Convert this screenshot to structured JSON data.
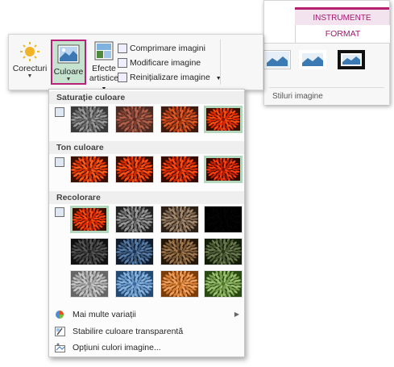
{
  "context_tab": {
    "group_title": "INSTRUMENTE IMAGINE",
    "tab_label": "FORMAT",
    "styles_group_label": "Stiluri imagine"
  },
  "ribbon": {
    "corecturi_label": "Corecturi",
    "culoare_label": "Culoare",
    "efecte_label_1": "Efecte",
    "efecte_label_2": "artistice",
    "comprimare_label": "Comprimare imagini",
    "modificare_label": "Modificare imagine",
    "reinitializare_label": "Reinițializare imagine"
  },
  "menu": {
    "saturatie_header": "Saturație culoare",
    "ton_header": "Ton culoare",
    "recolorare_header": "Recolorare",
    "items": [
      {
        "label": "Mai multe variații",
        "has_submenu": true
      },
      {
        "label": "Stabilire culoare transparentă",
        "has_submenu": false
      },
      {
        "label": "Opțiuni culori imagine...",
        "has_submenu": false
      }
    ]
  },
  "colors": {
    "accent_magenta": "#b4226f",
    "selected_green": "#c5e3cf",
    "selected_border": "#b2d7bd"
  }
}
